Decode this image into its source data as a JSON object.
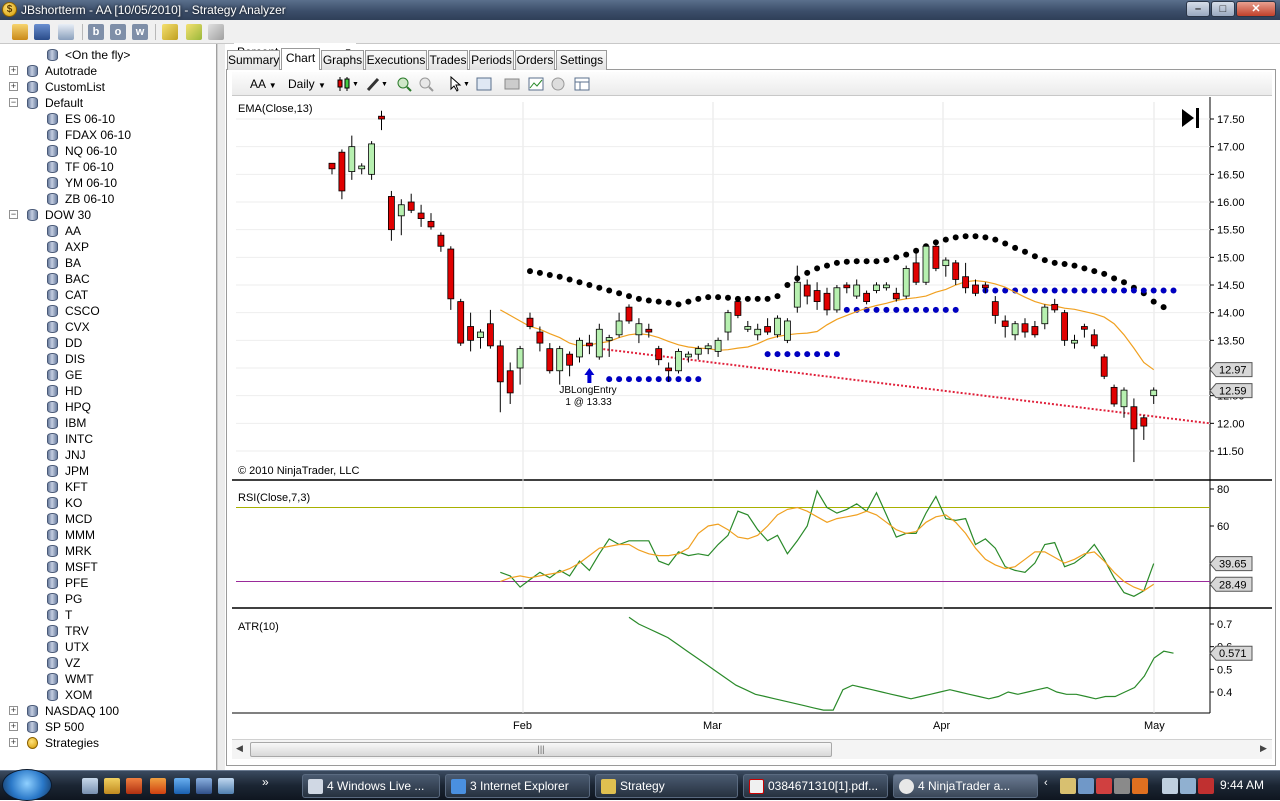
{
  "window": {
    "title": "JBshortterm - AA [10/05/2010] - Strategy Analyzer"
  },
  "toolbar": {
    "analysis_type": "Percent",
    "letter_buttons": [
      "b",
      "o",
      "w"
    ]
  },
  "tree": {
    "items": [
      {
        "label": "<On the fly>",
        "level": 1,
        "expander": ""
      },
      {
        "label": "Autotrade",
        "level": 0,
        "expander": "+"
      },
      {
        "label": "CustomList",
        "level": 0,
        "expander": "+"
      },
      {
        "label": "Default",
        "level": 0,
        "expander": "−"
      },
      {
        "label": "ES 06-10",
        "level": 1,
        "expander": ""
      },
      {
        "label": "FDAX 06-10",
        "level": 1,
        "expander": ""
      },
      {
        "label": "NQ 06-10",
        "level": 1,
        "expander": ""
      },
      {
        "label": "TF 06-10",
        "level": 1,
        "expander": ""
      },
      {
        "label": "YM 06-10",
        "level": 1,
        "expander": ""
      },
      {
        "label": "ZB 06-10",
        "level": 1,
        "expander": ""
      },
      {
        "label": "DOW 30",
        "level": 0,
        "expander": "−"
      },
      {
        "label": "AA",
        "level": 1,
        "expander": ""
      },
      {
        "label": "AXP",
        "level": 1,
        "expander": ""
      },
      {
        "label": "BA",
        "level": 1,
        "expander": ""
      },
      {
        "label": "BAC",
        "level": 1,
        "expander": ""
      },
      {
        "label": "CAT",
        "level": 1,
        "expander": ""
      },
      {
        "label": "CSCO",
        "level": 1,
        "expander": ""
      },
      {
        "label": "CVX",
        "level": 1,
        "expander": ""
      },
      {
        "label": "DD",
        "level": 1,
        "expander": ""
      },
      {
        "label": "DIS",
        "level": 1,
        "expander": ""
      },
      {
        "label": "GE",
        "level": 1,
        "expander": ""
      },
      {
        "label": "HD",
        "level": 1,
        "expander": ""
      },
      {
        "label": "HPQ",
        "level": 1,
        "expander": ""
      },
      {
        "label": "IBM",
        "level": 1,
        "expander": ""
      },
      {
        "label": "INTC",
        "level": 1,
        "expander": ""
      },
      {
        "label": "JNJ",
        "level": 1,
        "expander": ""
      },
      {
        "label": "JPM",
        "level": 1,
        "expander": ""
      },
      {
        "label": "KFT",
        "level": 1,
        "expander": ""
      },
      {
        "label": "KO",
        "level": 1,
        "expander": ""
      },
      {
        "label": "MCD",
        "level": 1,
        "expander": ""
      },
      {
        "label": "MMM",
        "level": 1,
        "expander": ""
      },
      {
        "label": "MRK",
        "level": 1,
        "expander": ""
      },
      {
        "label": "MSFT",
        "level": 1,
        "expander": ""
      },
      {
        "label": "PFE",
        "level": 1,
        "expander": ""
      },
      {
        "label": "PG",
        "level": 1,
        "expander": ""
      },
      {
        "label": "T",
        "level": 1,
        "expander": ""
      },
      {
        "label": "TRV",
        "level": 1,
        "expander": ""
      },
      {
        "label": "UTX",
        "level": 1,
        "expander": ""
      },
      {
        "label": "VZ",
        "level": 1,
        "expander": ""
      },
      {
        "label": "WMT",
        "level": 1,
        "expander": ""
      },
      {
        "label": "XOM",
        "level": 1,
        "expander": ""
      },
      {
        "label": "NASDAQ 100",
        "level": 0,
        "expander": "+"
      },
      {
        "label": "SP 500",
        "level": 0,
        "expander": "+"
      },
      {
        "label": "Strategies",
        "level": 0,
        "expander": "+",
        "icon": "gold"
      }
    ],
    "selected": "AA"
  },
  "tabs": [
    "Summary",
    "Chart",
    "Graphs",
    "Executions",
    "Trades",
    "Periods",
    "Orders",
    "Settings"
  ],
  "active_tab": "Chart",
  "chart_toolbar": {
    "instrument": "AA",
    "interval": "Daily"
  },
  "chart_data": {
    "type": "candlestick",
    "instrument": "AA",
    "interval": "Daily",
    "copyright": "© 2010 NinjaTrader, LLC",
    "x_ticks": [
      "Feb",
      "Mar",
      "Apr",
      "May"
    ],
    "price_panel": {
      "label": "EMA(Close,13)",
      "ylim": [
        11.3,
        17.7
      ],
      "y_ticks": [
        "17.50",
        "17.00",
        "16.50",
        "16.00",
        "15.50",
        "15.00",
        "14.50",
        "14.00",
        "13.50",
        "13.00",
        "12.50",
        "12.00",
        "11.50"
      ],
      "last_value_labels": [
        "12.97",
        "12.59"
      ],
      "candles": [
        [
          16.7,
          16.7,
          16.5,
          16.6
        ],
        [
          16.9,
          16.95,
          16.05,
          16.2
        ],
        [
          16.55,
          17.2,
          16.4,
          17.0
        ],
        [
          16.6,
          16.7,
          16.5,
          16.65
        ],
        [
          16.5,
          17.1,
          16.4,
          17.05
        ],
        [
          17.55,
          17.65,
          17.3,
          17.5
        ],
        [
          16.1,
          16.2,
          15.3,
          15.5
        ],
        [
          15.75,
          16.05,
          15.4,
          15.95
        ],
        [
          16.0,
          16.15,
          15.8,
          15.85
        ],
        [
          15.8,
          15.95,
          15.55,
          15.7
        ],
        [
          15.65,
          15.8,
          15.5,
          15.55
        ],
        [
          15.4,
          15.45,
          15.1,
          15.2
        ],
        [
          15.15,
          15.2,
          14.05,
          14.25
        ],
        [
          14.2,
          14.25,
          13.4,
          13.45
        ],
        [
          13.75,
          14.0,
          13.3,
          13.5
        ],
        [
          13.55,
          13.7,
          13.35,
          13.65
        ],
        [
          13.8,
          14.05,
          13.35,
          13.4
        ],
        [
          13.4,
          13.5,
          12.2,
          12.75
        ],
        [
          12.95,
          13.1,
          12.35,
          12.55
        ],
        [
          13.0,
          13.4,
          12.7,
          13.35
        ],
        [
          13.9,
          14.0,
          13.7,
          13.75
        ],
        [
          13.65,
          13.75,
          13.3,
          13.45
        ],
        [
          13.35,
          13.45,
          12.9,
          12.95
        ],
        [
          12.95,
          13.4,
          12.7,
          13.35
        ],
        [
          13.25,
          13.3,
          12.85,
          13.05
        ],
        [
          13.2,
          13.55,
          13.1,
          13.5
        ],
        [
          13.45,
          13.6,
          13.25,
          13.4
        ],
        [
          13.2,
          13.8,
          13.15,
          13.7
        ],
        [
          13.5,
          13.6,
          13.2,
          13.55
        ],
        [
          13.6,
          14.0,
          13.55,
          13.85
        ],
        [
          14.1,
          14.15,
          13.8,
          13.85
        ],
        [
          13.6,
          13.9,
          13.45,
          13.8
        ],
        [
          13.7,
          13.8,
          13.55,
          13.65
        ],
        [
          13.35,
          13.4,
          13.05,
          13.15
        ],
        [
          13.0,
          13.1,
          12.75,
          12.95
        ],
        [
          12.95,
          13.35,
          12.9,
          13.3
        ],
        [
          13.2,
          13.3,
          13.1,
          13.25
        ],
        [
          13.25,
          13.4,
          13.15,
          13.35
        ],
        [
          13.35,
          13.45,
          13.25,
          13.4
        ],
        [
          13.3,
          13.55,
          13.2,
          13.5
        ],
        [
          13.65,
          14.05,
          13.5,
          14.0
        ],
        [
          14.2,
          14.3,
          13.9,
          13.95
        ],
        [
          13.7,
          13.85,
          13.65,
          13.75
        ],
        [
          13.6,
          13.8,
          13.5,
          13.7
        ],
        [
          13.75,
          13.9,
          13.6,
          13.65
        ],
        [
          13.6,
          13.95,
          13.55,
          13.9
        ],
        [
          13.5,
          13.9,
          13.45,
          13.85
        ],
        [
          14.1,
          14.85,
          14.0,
          14.55
        ],
        [
          14.5,
          14.6,
          14.15,
          14.3
        ],
        [
          14.4,
          14.55,
          14.05,
          14.2
        ],
        [
          14.35,
          14.45,
          13.95,
          14.05
        ],
        [
          14.05,
          14.5,
          14.0,
          14.45
        ],
        [
          14.5,
          14.55,
          14.35,
          14.45
        ],
        [
          14.3,
          14.6,
          14.25,
          14.5
        ],
        [
          14.35,
          14.4,
          14.15,
          14.2
        ],
        [
          14.4,
          14.55,
          14.35,
          14.5
        ],
        [
          14.45,
          14.55,
          14.4,
          14.5
        ],
        [
          14.35,
          14.45,
          14.2,
          14.25
        ],
        [
          14.3,
          14.85,
          14.25,
          14.8
        ],
        [
          14.9,
          15.1,
          14.5,
          14.55
        ],
        [
          14.55,
          15.25,
          14.5,
          15.2
        ],
        [
          15.2,
          15.3,
          14.75,
          14.8
        ],
        [
          14.85,
          15.0,
          14.65,
          14.95
        ],
        [
          14.9,
          14.95,
          14.5,
          14.6
        ],
        [
          14.65,
          14.9,
          14.35,
          14.45
        ],
        [
          14.5,
          14.6,
          14.3,
          14.35
        ],
        [
          14.5,
          14.55,
          14.35,
          14.45
        ],
        [
          14.2,
          14.3,
          13.8,
          13.95
        ],
        [
          13.85,
          13.95,
          13.55,
          13.75
        ],
        [
          13.6,
          13.85,
          13.5,
          13.8
        ],
        [
          13.8,
          13.9,
          13.55,
          13.65
        ],
        [
          13.75,
          13.85,
          13.55,
          13.6
        ],
        [
          13.8,
          14.15,
          13.7,
          14.1
        ],
        [
          14.15,
          14.25,
          14.0,
          14.05
        ],
        [
          14.0,
          14.05,
          13.4,
          13.5
        ],
        [
          13.45,
          13.6,
          13.35,
          13.5
        ],
        [
          13.75,
          13.8,
          13.55,
          13.7
        ],
        [
          13.6,
          13.7,
          13.35,
          13.4
        ],
        [
          13.2,
          13.25,
          12.8,
          12.85
        ],
        [
          12.65,
          12.7,
          12.3,
          12.35
        ],
        [
          12.3,
          12.65,
          12.1,
          12.6
        ],
        [
          12.3,
          12.45,
          11.3,
          11.9
        ],
        [
          12.1,
          12.15,
          11.7,
          11.95
        ],
        [
          12.5,
          12.65,
          12.35,
          12.6
        ]
      ],
      "ema": [
        14.05,
        13.95,
        13.85,
        13.75,
        13.7,
        13.62,
        13.55,
        13.45,
        13.4,
        13.42,
        13.45,
        13.48,
        13.55,
        13.6,
        13.62,
        13.6,
        13.55,
        13.48,
        13.42,
        13.38,
        13.36,
        13.35,
        13.32,
        13.33,
        13.36,
        13.38,
        13.44,
        13.52,
        13.57,
        13.6,
        13.62,
        13.63,
        13.66,
        13.78,
        13.88,
        13.95,
        14.02,
        14.08,
        14.13,
        14.17,
        14.22,
        14.25,
        14.27,
        14.3,
        14.37,
        14.42,
        14.5,
        14.56,
        14.58,
        14.56,
        14.52,
        14.46,
        14.37,
        14.28,
        14.2,
        14.15,
        14.12,
        14.08,
        14.06,
        14.02,
        13.98,
        13.92,
        13.8,
        13.6,
        13.36,
        13.1,
        12.97
      ],
      "ema_start_index": 17,
      "black_dots": [
        14.75,
        14.72,
        14.68,
        14.65,
        14.6,
        14.55,
        14.5,
        14.45,
        14.4,
        14.35,
        14.3,
        14.25,
        14.22,
        14.2,
        14.18,
        14.15,
        14.2,
        14.25,
        14.28,
        14.28,
        14.27,
        14.25,
        14.25,
        14.25,
        14.25,
        14.3,
        14.5,
        14.62,
        14.72,
        14.8,
        14.85,
        14.9,
        14.92,
        14.93,
        14.93,
        14.93,
        14.95,
        15.0,
        15.05,
        15.12,
        15.2,
        15.27,
        15.32,
        15.36,
        15.38,
        15.38,
        15.36,
        15.32,
        15.25,
        15.17,
        15.1,
        15.02,
        14.95,
        14.9,
        14.88,
        14.85,
        14.8,
        14.75,
        14.7,
        14.62,
        14.55,
        14.45,
        14.35,
        14.2,
        14.1
      ],
      "blue_levels": [
        {
          "from": 28,
          "to": 37,
          "value": 12.8
        },
        {
          "from": 44,
          "to": 51,
          "value": 13.25
        },
        {
          "from": 52,
          "to": 63,
          "value": 14.05
        },
        {
          "from": 65,
          "to": 85,
          "value": 14.4
        }
      ],
      "trendline": {
        "from_value": 13.35,
        "to_value": 12.0
      },
      "entry_marker": {
        "label": "JBLongEntry",
        "fill": "1 @ 13.33"
      }
    },
    "rsi_panel": {
      "label": "RSI(Close,7,3)",
      "y_ticks": [
        "80",
        "60"
      ],
      "levels": [
        70,
        30
      ],
      "last_value_labels": [
        "39.65",
        "28.49"
      ],
      "rsi": [
        35,
        33,
        27,
        31,
        35,
        32,
        36,
        33,
        41,
        36,
        45,
        53,
        50,
        52,
        52,
        52,
        41,
        39,
        46,
        44,
        45,
        44,
        50,
        55,
        68,
        66,
        58,
        52,
        55,
        45,
        52,
        60,
        79,
        70,
        67,
        69,
        72,
        68,
        78,
        66,
        54,
        56,
        56,
        67,
        76,
        64,
        63,
        64,
        50,
        53,
        48,
        38,
        36,
        35,
        40,
        50,
        51,
        38,
        40,
        44,
        50,
        42,
        32,
        24,
        22,
        25,
        39.65
      ],
      "signal": [
        30,
        32,
        33,
        32,
        33,
        34,
        35,
        37,
        40,
        44,
        48,
        49,
        50,
        50,
        47,
        45,
        44,
        44,
        45,
        48,
        56,
        60,
        61,
        58,
        54,
        53,
        55,
        60,
        66,
        69,
        70,
        68,
        65,
        62,
        64,
        65,
        66,
        68,
        66,
        62,
        58,
        56,
        57,
        62,
        65,
        66,
        62,
        56,
        48,
        42,
        39,
        37,
        38,
        42,
        46,
        46,
        43,
        40,
        42,
        45,
        46,
        41,
        35,
        30,
        27,
        25,
        28.49
      ]
    },
    "atr_panel": {
      "label": "ATR(10)",
      "y_ticks": [
        "0.7",
        "0.6",
        "0.5",
        "0.4"
      ],
      "last_value_labels": [
        "0.571"
      ],
      "atr": [
        0.73,
        0.7,
        0.68,
        0.66,
        0.64,
        0.61,
        0.58,
        0.55,
        0.52,
        0.49,
        0.46,
        0.43,
        0.41,
        0.39,
        0.38,
        0.37,
        0.36,
        0.35,
        0.34,
        0.33,
        0.32,
        0.32,
        0.41,
        0.43,
        0.42,
        0.41,
        0.4,
        0.39,
        0.38,
        0.37,
        0.38,
        0.39,
        0.4,
        0.41,
        0.4,
        0.39,
        0.38,
        0.37,
        0.38,
        0.4,
        0.39,
        0.4,
        0.41,
        0.42,
        0.4,
        0.39,
        0.39,
        0.38,
        0.37,
        0.38,
        0.38,
        0.4,
        0.42,
        0.47,
        0.55,
        0.58,
        0.571
      ]
    }
  },
  "taskbar": {
    "buttons": [
      "4 Windows Live ...",
      "3 Internet Explorer",
      "Strategy",
      "0384671310[1].pdf...",
      "4 NinjaTrader a..."
    ],
    "clock": "9:44 AM"
  },
  "colors": {
    "up_candle": "#b7f0b0",
    "down_candle": "#e00000",
    "ema": "#f0a020",
    "dots_black": "#000000",
    "dots_blue": "#0000c0",
    "rsi": "#2a8a2a",
    "atr": "#2a8a2a"
  }
}
